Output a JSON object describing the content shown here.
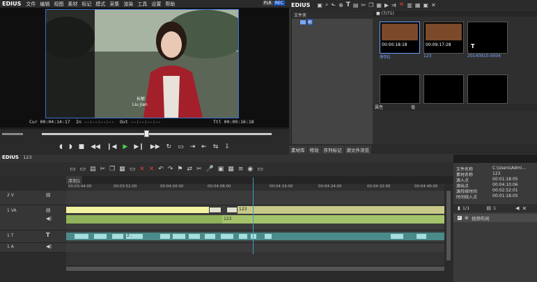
{
  "menubar": {
    "brand": "EDIUS",
    "items": [
      "文件",
      "编辑",
      "视图",
      "素材",
      "标记",
      "模式",
      "采集",
      "渲染",
      "工具",
      "设置",
      "帮助"
    ],
    "plr": "PLR",
    "rec": "REC"
  },
  "player": {
    "subtitle_line1": "长郁",
    "subtitle_line2": "Liu Jian",
    "cur": "Cur 00:04:14:17",
    "in": "In --:--:--:--",
    "out": "Out --:--:--:--",
    "ttl": "Ttl 00:09:16:18"
  },
  "bin": {
    "brand": "EDIUS",
    "folder_header": "文件夹",
    "root_folder": "根",
    "bin_path": "■ (7/71)",
    "clips": [
      {
        "label": "序列1",
        "tc": "00:00:18:18"
      },
      {
        "label": "123",
        "tc": "00:09:17:28"
      },
      {
        "label": "20140910-0004",
        "tc": ""
      }
    ],
    "prop_col1": "属性",
    "prop_col2": "值"
  },
  "right_tabs": [
    "素材库",
    "特效",
    "序列标记",
    "源文件浏览"
  ],
  "timeline": {
    "brand": "EDIUS",
    "project": "123",
    "sequence_tab": "序列1",
    "ruler": [
      "00:03:44:00",
      "00:03:52:00",
      "00:04:00:00",
      "00:04:08:00",
      "00:04:16:00",
      "00:04:24:00",
      "00:04:32:00",
      "00:04:40:00"
    ],
    "tracks": [
      {
        "name": "2 V"
      },
      {
        "name": "1 VA"
      },
      {
        "name": "1 T"
      },
      {
        "name": "1 A"
      }
    ],
    "clip_label": "123",
    "title_clip_label": "2..."
  },
  "properties": {
    "rows": [
      {
        "k": "文件名称",
        "v": "C:\\Users\\Admi..."
      },
      {
        "k": "素材名称",
        "v": "123"
      },
      {
        "k": "源入点",
        "v": "00:01:18:05"
      },
      {
        "k": "源出点",
        "v": "00:04:10:06"
      },
      {
        "k": "源持续时间",
        "v": "00:02:52:01"
      },
      {
        "k": "时间线入点",
        "v": "00:01:18:05"
      }
    ],
    "page": "1/1",
    "count": "1",
    "layout_label": "视频布局"
  }
}
